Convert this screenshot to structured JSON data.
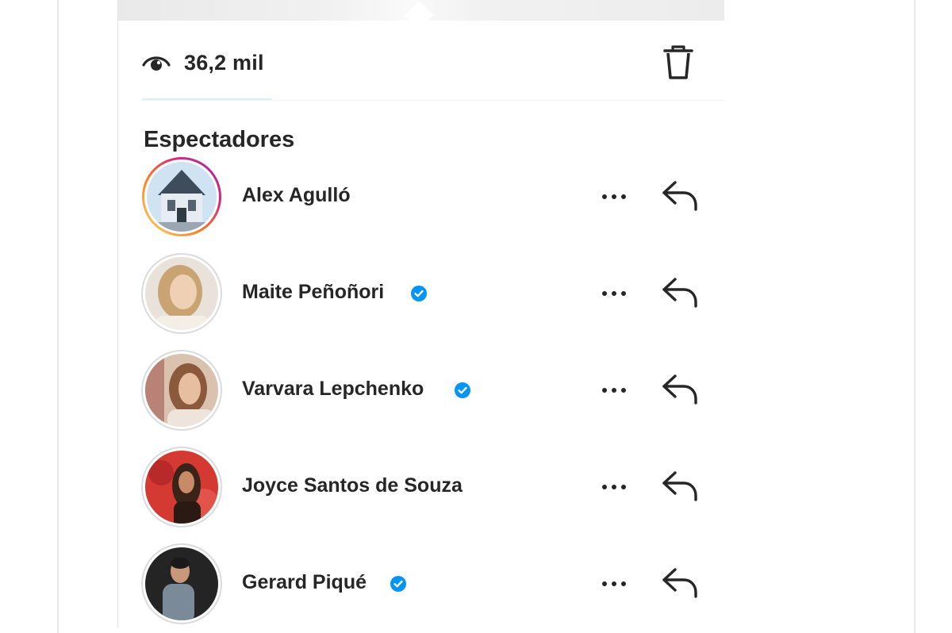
{
  "story": {
    "views": "36,2 mil",
    "colors": {
      "text": "#262626",
      "verified": "#0095f6",
      "ring": "#d62976"
    }
  },
  "viewers_section": {
    "title": "Espectadores",
    "viewers": [
      {
        "name": "Alex Agulló",
        "verified": false,
        "story_ring": true
      },
      {
        "name": "Maite Peñoñori",
        "verified": true,
        "story_ring": false
      },
      {
        "name": "Varvara Lepchenko",
        "verified": true,
        "story_ring": false
      },
      {
        "name": "Joyce Santos de Souza",
        "verified": false,
        "story_ring": false
      },
      {
        "name": "Gerard Piqué",
        "verified": true,
        "story_ring": false
      }
    ]
  },
  "icons": {
    "views": "eye-icon",
    "delete": "trash-icon",
    "more": "more-horizontal-icon",
    "reply": "reply-arrow-icon",
    "verified": "verified-badge-icon"
  }
}
